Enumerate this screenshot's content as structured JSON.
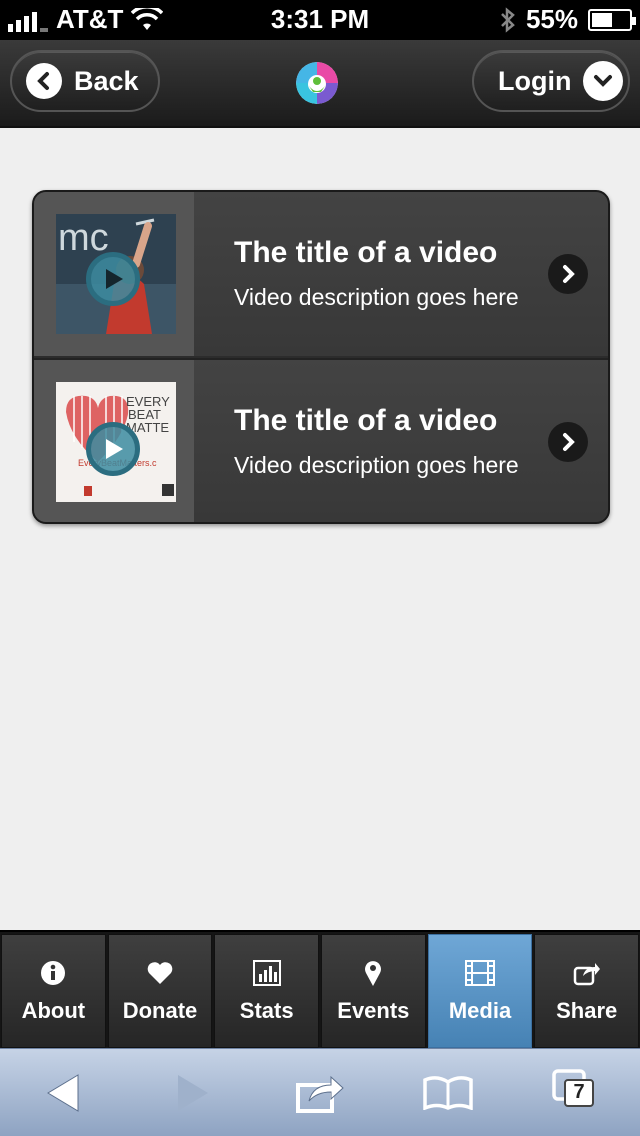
{
  "status_bar": {
    "carrier": "AT&T",
    "time": "3:31 PM",
    "battery": "55%",
    "battery_level": 0.55
  },
  "header": {
    "back_label": "Back",
    "login_label": "Login"
  },
  "videos": [
    {
      "title": "The title of a video",
      "description": "Video description goes here"
    },
    {
      "title": "The title of a video",
      "description": "Video description goes here"
    }
  ],
  "tabs": [
    {
      "label": "About",
      "icon": "info-icon"
    },
    {
      "label": "Donate",
      "icon": "heart-icon"
    },
    {
      "label": "Stats",
      "icon": "bar-chart-icon"
    },
    {
      "label": "Events",
      "icon": "map-pin-icon"
    },
    {
      "label": "Media",
      "icon": "film-icon",
      "active": true
    },
    {
      "label": "Share",
      "icon": "share-icon"
    }
  ],
  "safari": {
    "tab_count": "7"
  },
  "colors": {
    "active_tab": "#5a96c8",
    "header_bg": "#2a2a2a",
    "play_accent": "#2b6d80"
  }
}
